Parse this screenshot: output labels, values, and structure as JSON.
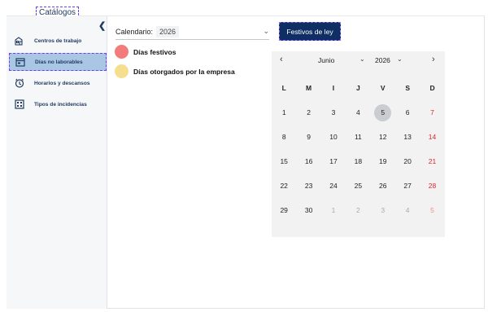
{
  "top_tab": {
    "label": "Catálogos"
  },
  "sidebar": {
    "items": [
      {
        "label": "Centros de trabajo",
        "icon": "building-icon"
      },
      {
        "label": "Días no laborables",
        "icon": "calendar-icon"
      },
      {
        "label": "Horarios y descansos",
        "icon": "clock-icon"
      },
      {
        "label": "Tipos de incidencias",
        "icon": "grid-icon"
      }
    ],
    "active_index": 1
  },
  "calendar_select": {
    "label": "Calendario:",
    "value": "2026"
  },
  "festivos_button": {
    "label": "Festivos de ley"
  },
  "legend": [
    {
      "label": "Días festivos",
      "color": "#f47b7b"
    },
    {
      "label": "Días otorgados por la empresa",
      "color": "#f6de8f"
    }
  ],
  "calendar": {
    "month": "Junio",
    "year": "2026",
    "prev": "‹",
    "next": "›",
    "weekdays": [
      "L",
      "M",
      "I",
      "J",
      "V",
      "S",
      "D"
    ],
    "weeks": [
      [
        "1",
        "2",
        "3",
        "4",
        "5",
        "6",
        "7"
      ],
      [
        "8",
        "9",
        "10",
        "11",
        "12",
        "13",
        "14"
      ],
      [
        "15",
        "16",
        "17",
        "18",
        "19",
        "20",
        "21"
      ],
      [
        "22",
        "23",
        "24",
        "25",
        "26",
        "27",
        "28"
      ],
      [
        "29",
        "30",
        "1",
        "2",
        "3",
        "4",
        "5"
      ]
    ],
    "today": "5",
    "colors": {
      "sunday": "#e0242c",
      "today_bg": "#c9ccd1"
    }
  }
}
